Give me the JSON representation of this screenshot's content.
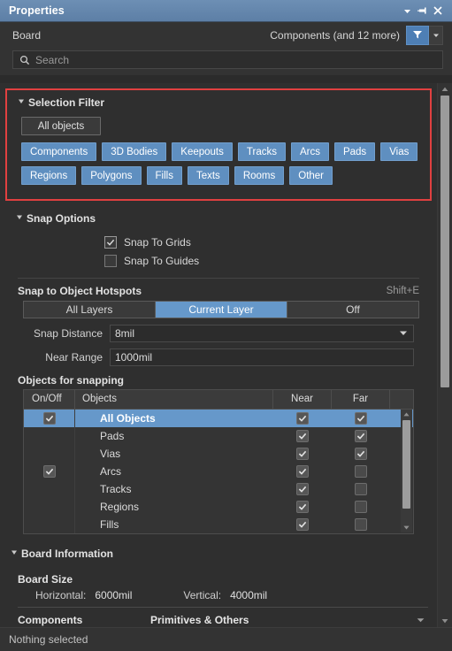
{
  "titlebar": {
    "title": "Properties",
    "buttons": [
      {
        "name": "dropdown-menu-icon",
        "glyph": "▼"
      },
      {
        "name": "pin-icon",
        "glyph": "pin"
      },
      {
        "name": "close-icon",
        "glyph": "✕"
      }
    ]
  },
  "header": {
    "scope_label": "Board",
    "object_selection": "Components (and 12 more)",
    "filter_button": "filter-icon",
    "filter_dropdown": "▼"
  },
  "search": {
    "placeholder": "Search",
    "value": "",
    "icon": "search-icon"
  },
  "selection_filter": {
    "title": "Selection Filter",
    "collapse_glyph": "◢",
    "all_objects_button": "All objects",
    "chips": [
      "Components",
      "3D Bodies",
      "Keepouts",
      "Tracks",
      "Arcs",
      "Pads",
      "Vias",
      "Regions",
      "Polygons",
      "Fills",
      "Texts",
      "Rooms",
      "Other"
    ],
    "highlight_color": "#e04040",
    "chip_color": "#5f8fc0"
  },
  "snap_options": {
    "title": "Snap Options",
    "collapse_glyph": "◢",
    "checkboxes": [
      {
        "label": "Snap To Grids",
        "checked": true
      },
      {
        "label": "Snap To Guides",
        "checked": false
      }
    ],
    "hotspots_title": "Snap to Object Hotspots",
    "hotspots_shortcut": "Shift+E",
    "hotspot_options": [
      {
        "label": "All Layers",
        "selected": false
      },
      {
        "label": "Current Layer",
        "selected": true
      },
      {
        "label": "Off",
        "selected": false
      }
    ],
    "fields": [
      {
        "label": "Snap Distance",
        "value": "8mil",
        "type": "dropdown"
      },
      {
        "label": "Near Range",
        "value": "1000mil",
        "type": "text"
      }
    ],
    "table_title": "Objects for snapping",
    "table": {
      "columns": [
        "On/Off",
        "Objects",
        "Near",
        "Far"
      ],
      "rows": [
        {
          "on": true,
          "object": "All Objects",
          "near": true,
          "far": true,
          "selected": true
        },
        {
          "on": null,
          "object": "Pads",
          "near": true,
          "far": true,
          "selected": false
        },
        {
          "on": null,
          "object": "Vias",
          "near": true,
          "far": true,
          "selected": false
        },
        {
          "on": true,
          "object": "Arcs",
          "near": true,
          "far": false,
          "selected": false
        },
        {
          "on": null,
          "object": "Tracks",
          "near": true,
          "far": false,
          "selected": false
        },
        {
          "on": null,
          "object": "Regions",
          "near": true,
          "far": false,
          "selected": false
        },
        {
          "on": null,
          "object": "Fills",
          "near": true,
          "far": false,
          "selected": false
        }
      ]
    }
  },
  "board_information": {
    "title": "Board Information",
    "collapse_glyph": "◢",
    "board_size_title": "Board Size",
    "horizontal_label": "Horizontal:",
    "horizontal_value": "6000mil",
    "vertical_label": "Vertical:",
    "vertical_value": "4000mil",
    "components_label": "Components",
    "primitives_label": "Primitives & Others"
  },
  "status": {
    "text": "Nothing selected"
  }
}
